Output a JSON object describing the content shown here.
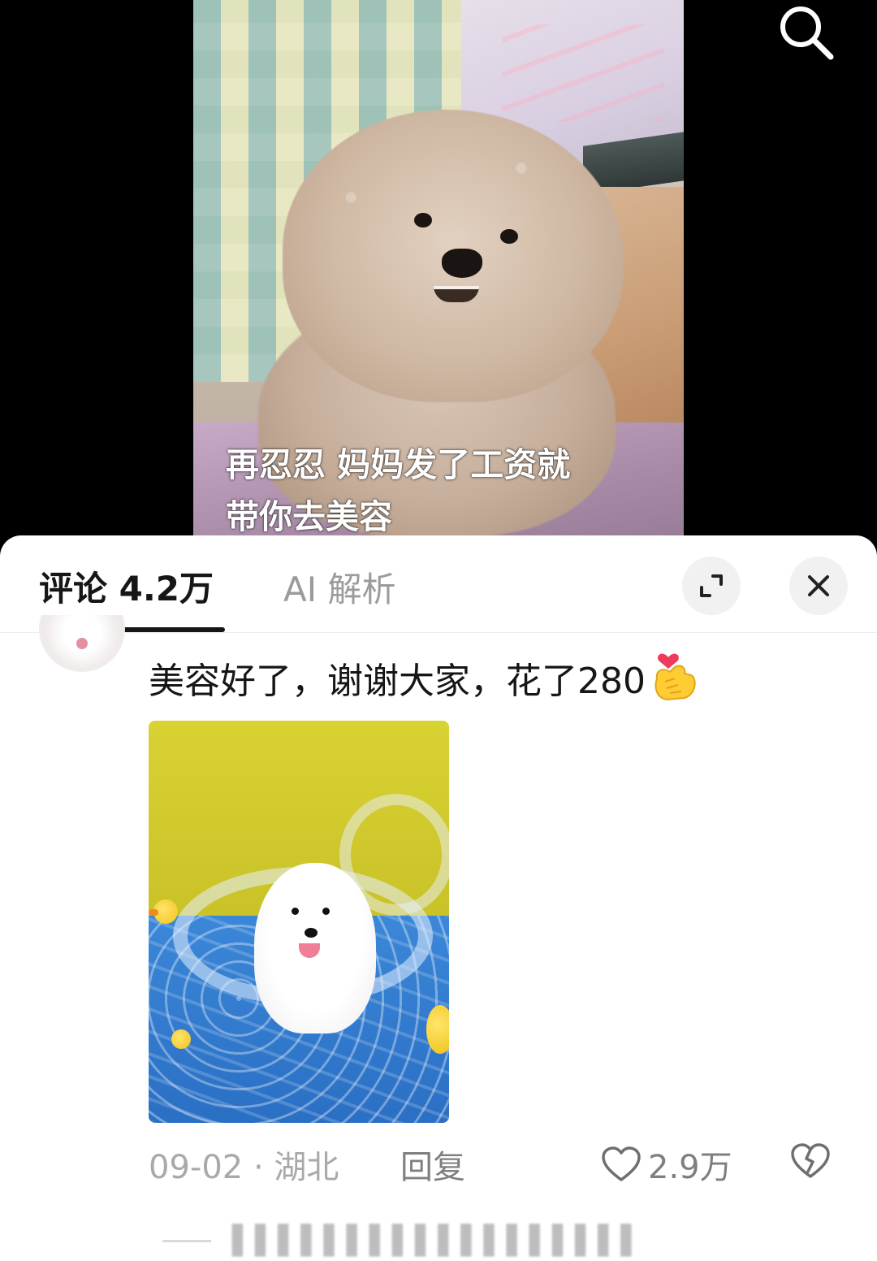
{
  "video": {
    "subtitle_line1": "再忍忍 妈妈发了工资就",
    "subtitle_line2": "带你去美容"
  },
  "top_actions": {
    "search_icon": "search-icon"
  },
  "comments_panel": {
    "tabs": [
      {
        "label": "评论 4.2万",
        "active": true
      },
      {
        "label": "AI 解析",
        "active": false
      }
    ],
    "expand_icon": "expand-icon",
    "close_icon": "close-icon"
  },
  "comment": {
    "text": "美容好了，谢谢大家，花了280",
    "emoji": "finger-heart-emoji",
    "date_location": "09-02 · 湖北",
    "reply_label": "回复",
    "like_count": "2.9万",
    "like_icon": "heart-outline-icon",
    "dislike_icon": "broken-heart-icon"
  },
  "colors": {
    "sheet_bg": "#ffffff",
    "active_tab": "#161616",
    "inactive_tab": "#9b9b9b",
    "meta_text": "#a9a9a9"
  }
}
